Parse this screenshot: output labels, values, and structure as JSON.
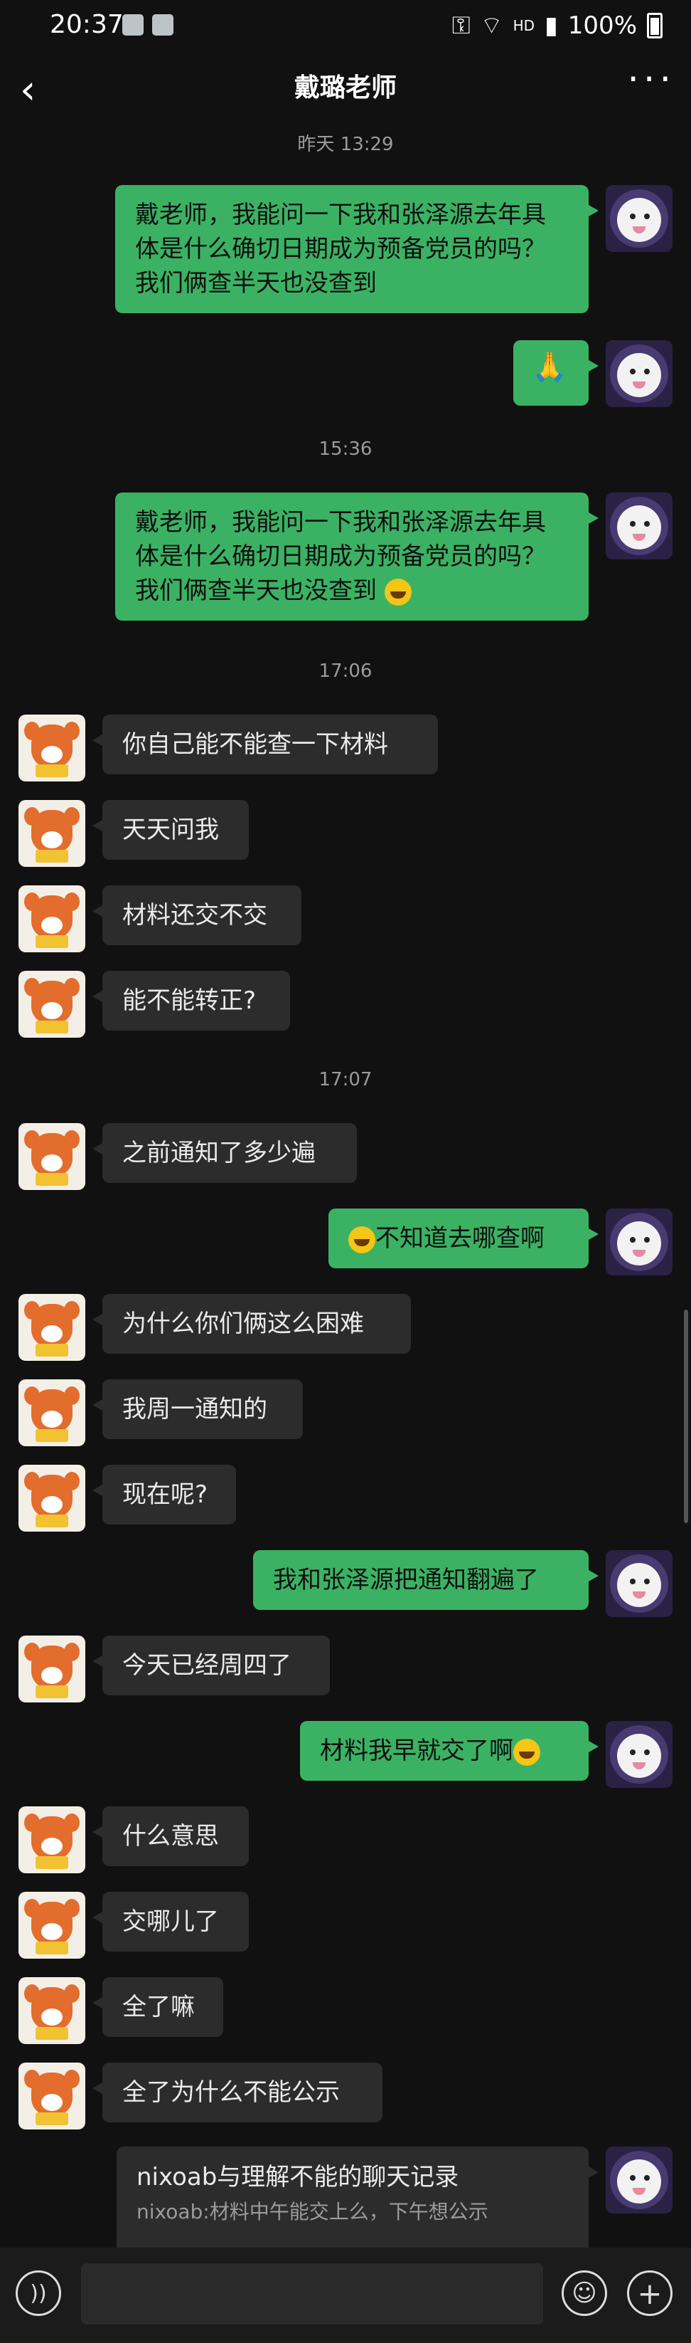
{
  "status_bar": {
    "time": "20:37",
    "hd": "HD",
    "battery": "100%"
  },
  "header": {
    "title": "戴璐老师",
    "back_icon": "chevron-left-icon",
    "more_icon": "more-dots-icon"
  },
  "timestamps": [
    "昨天 13:29",
    "15:36",
    "17:06",
    "17:07"
  ],
  "messages": {
    "m1": "戴老师，我能问一下我和张泽源去年具体是什么确切日期成为预备党员的吗？我们俩查半天也没查到",
    "m2": "🙏",
    "m3": "戴老师，我能问一下我和张泽源去年具体是什么确切日期成为预备党员的吗？我们俩查半天也没查到",
    "m4": "你自己能不能查一下材料",
    "m5": "天天问我",
    "m6": "材料还交不交",
    "m7": "能不能转正?",
    "m8": "之前通知了多少遍",
    "m9": "不知道去哪查啊",
    "m10": "为什么你们俩这么困难",
    "m11": "我周一通知的",
    "m12": "现在呢?",
    "m13": "我和张泽源把通知翻遍了",
    "m14": "今天已经周四了",
    "m15": "材料我早就交了啊",
    "m16": "什么意思",
    "m17": "交哪儿了",
    "m18": "全了嘛",
    "m19": "全了为什么不能公示"
  },
  "forward_card": {
    "title": "nixoab与理解不能的聊天记录",
    "preview": "nixoab:材料中午能交上么，下午想公示"
  },
  "composer": {
    "placeholder": ""
  },
  "colors": {
    "outgoing": "#3bb263",
    "incoming": "#2c2c2c",
    "background": "#111111"
  }
}
